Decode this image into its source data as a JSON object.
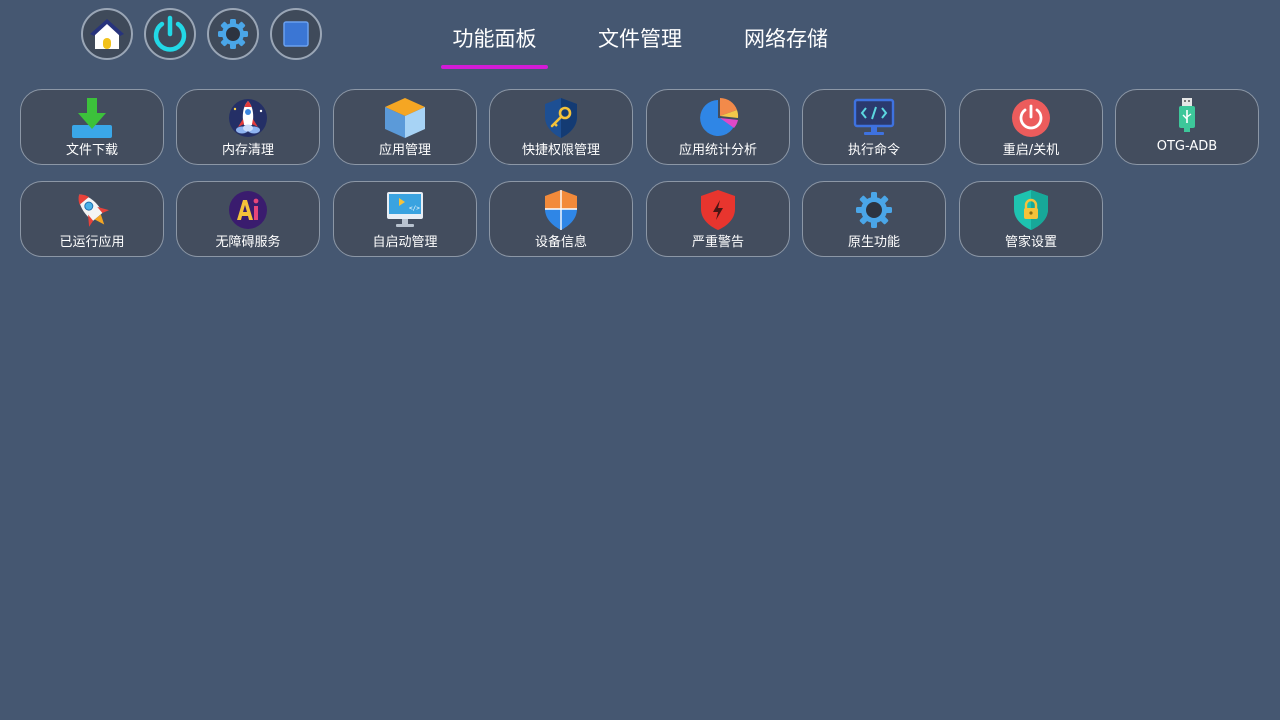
{
  "header": {
    "tabs": [
      {
        "label": "功能面板",
        "active": true
      },
      {
        "label": "文件管理",
        "active": false
      },
      {
        "label": "网络存储",
        "active": false
      }
    ],
    "tab_indicator_color": "#d21bd6",
    "buttons": [
      {
        "icon": "home-icon"
      },
      {
        "icon": "power-icon"
      },
      {
        "icon": "settings-gear-icon"
      },
      {
        "icon": "square-stop-icon"
      }
    ]
  },
  "tiles": [
    {
      "label": "文件下载",
      "icon": "download-icon"
    },
    {
      "label": "内存清理",
      "icon": "rocket-cleanup-icon"
    },
    {
      "label": "应用管理",
      "icon": "box-icon"
    },
    {
      "label": "快捷权限管理",
      "icon": "shield-key-icon"
    },
    {
      "label": "应用统计分析",
      "icon": "pie-chart-icon"
    },
    {
      "label": "执行命令",
      "icon": "code-monitor-icon"
    },
    {
      "label": "重启/关机",
      "icon": "power-icon"
    },
    {
      "label": "OTG-ADB",
      "icon": "usb-icon"
    },
    {
      "label": "已运行应用",
      "icon": "rocket-icon"
    },
    {
      "label": "无障碍服务",
      "icon": "ai-icon"
    },
    {
      "label": "自启动管理",
      "icon": "monitor-play-icon"
    },
    {
      "label": "设备信息",
      "icon": "shield-icon"
    },
    {
      "label": "严重警告",
      "icon": "shield-alert-icon"
    },
    {
      "label": "原生功能",
      "icon": "gear-icon"
    },
    {
      "label": "管家设置",
      "icon": "lock-shield-icon"
    }
  ]
}
